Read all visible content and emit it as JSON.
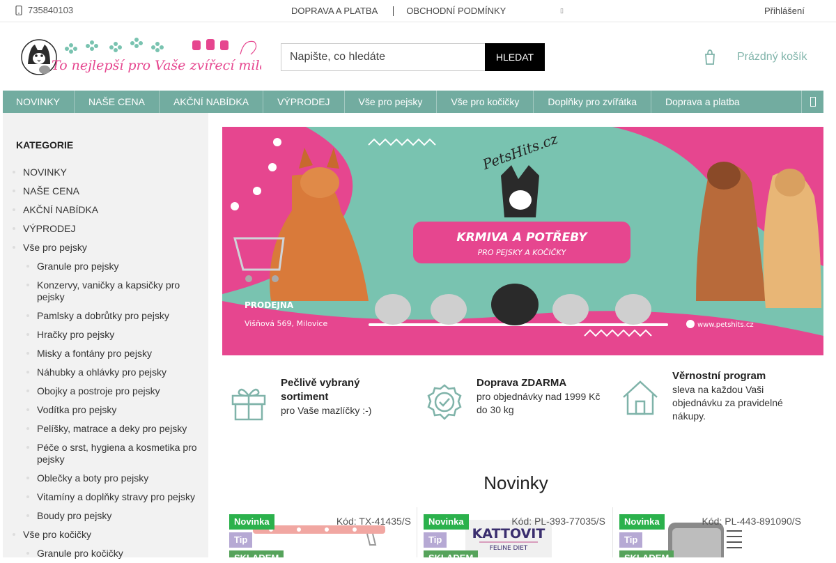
{
  "topbar": {
    "phone": "735840103",
    "links": [
      "DOPRAVA A PLATBA",
      "OBCHODNÍ PODMÍNKY"
    ],
    "login": "Přihlášení"
  },
  "logo": {
    "brand": "PetsHits.cz",
    "slogan": "To nejlepší pro Vaše zvířecí miláčky!"
  },
  "search": {
    "placeholder": "Napište, co hledáte",
    "button": "HLEDAT"
  },
  "cart": {
    "label": "Prázdný košík"
  },
  "nav": {
    "items": [
      "NOVINKY",
      "NAŠE CENA",
      "AKČNÍ NABÍDKA",
      "VÝPRODEJ",
      "Vše pro pejsky",
      "Vše pro kočičky",
      "Doplňky pro zvířátka",
      "Doprava a platba"
    ]
  },
  "sidebar": {
    "title": "KATEGORIE",
    "items": [
      {
        "label": "NOVINKY",
        "level": 1
      },
      {
        "label": "NAŠE CENA",
        "level": 1
      },
      {
        "label": "AKČNÍ NABÍDKA",
        "level": 1
      },
      {
        "label": "VÝPRODEJ",
        "level": 1
      },
      {
        "label": "Vše pro pejsky",
        "level": 1
      },
      {
        "label": "Granule pro pejsky",
        "level": 2
      },
      {
        "label": "Konzervy, vaničky a kapsičky pro pejsky",
        "level": 2
      },
      {
        "label": "Pamlsky a dobrůtky pro pejsky",
        "level": 2
      },
      {
        "label": "Hračky pro pejsky",
        "level": 2
      },
      {
        "label": "Misky a fontány pro pejsky",
        "level": 2
      },
      {
        "label": "Náhubky a ohlávky pro pejsky",
        "level": 2
      },
      {
        "label": "Obojky a postroje pro pejsky",
        "level": 2
      },
      {
        "label": "Vodítka pro pejsky",
        "level": 2
      },
      {
        "label": "Pelíšky, matrace a deky pro pejsky",
        "level": 2
      },
      {
        "label": "Péče o srst, hygiena a kosmetika pro pejsky",
        "level": 2
      },
      {
        "label": "Oblečky a boty pro pejsky",
        "level": 2
      },
      {
        "label": "Vitamíny a doplňky stravy pro pejsky",
        "level": 2
      },
      {
        "label": "Boudy pro pejsky",
        "level": 2
      },
      {
        "label": "Vše pro kočičky",
        "level": 1
      },
      {
        "label": "Granule pro kočičky",
        "level": 2
      }
    ]
  },
  "banner": {
    "brand": "PetsHits.cz",
    "headline": "KRMIVA A POTŘEBY",
    "subheadline": "PRO PEJSKY A KOČIČKY",
    "store_label": "PRODEJNA",
    "address": "Višňová 569, Milovice",
    "website": "www.petshits.cz"
  },
  "benefits": [
    {
      "title": "Pečlivě vybraný sortiment",
      "text": "pro Vaše mazlíčky :-)",
      "icon": "gift-icon"
    },
    {
      "title": "Doprava ZDARMA",
      "text": "pro objednávky nad 1999 Kč do 30 kg",
      "icon": "badge-check-icon"
    },
    {
      "title": "Věrnostní program",
      "text": "sleva na každou Vaši objednávku za pravidelné nákupy.",
      "icon": "house-icon"
    }
  ],
  "section_title": "Novinky",
  "products": [
    {
      "code": "Kód: TX-41435/S",
      "badges": [
        "Novinka",
        "Tip",
        "SKLADEM"
      ]
    },
    {
      "code": "Kód: PL-393-77035/S",
      "badges": [
        "Novinka",
        "Tip",
        "SKLADEM"
      ],
      "image_text": "KATTOVIT",
      "image_subtext": "FELINE DIET"
    },
    {
      "code": "Kód: PL-443-891090/S",
      "badges": [
        "Novinka",
        "Tip",
        "SKLADEM"
      ]
    }
  ],
  "colors": {
    "nav": "#72aca0",
    "accent": "#7fb3a9",
    "banner_green": "#79c3b0",
    "banner_pink": "#e6468f",
    "badge_new": "#2bb14c",
    "badge_tip": "#b6a9d4",
    "badge_stock": "#56a35b"
  }
}
